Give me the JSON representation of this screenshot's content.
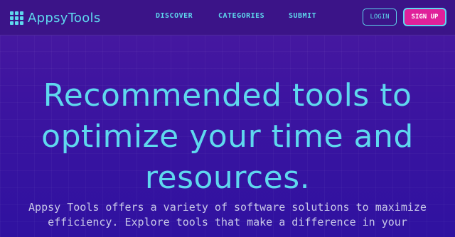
{
  "header": {
    "logo_text": "AppsyTools",
    "nav": {
      "discover": "DISCOVER",
      "categories": "CATEGORIES",
      "submit": "SUBMIT"
    },
    "login_label": "LOGIN",
    "signup_label": "SIGN UP"
  },
  "hero": {
    "title": "Recommended tools to optimize your time and resources.",
    "subtitle": "Appsy Tools offers a variety of software solutions to maximize efficiency. Explore tools that make a difference in your"
  },
  "colors": {
    "accent": "#5fd8ee",
    "signup_bg": "#e0209a",
    "background": "#3d14a0",
    "subtitle_text": "#c8c8e8"
  },
  "icons": {
    "logo": "grid-logo-icon"
  }
}
